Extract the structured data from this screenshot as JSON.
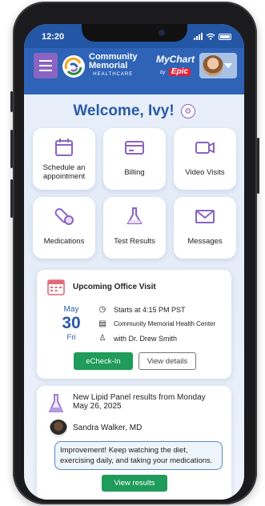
{
  "status_bar": {
    "time": "12:20"
  },
  "header": {
    "brand_line1": "Community",
    "brand_line2": "Memorial",
    "brand_line3": "HEALTHCARE",
    "mychart": "MyChart",
    "by": "by",
    "epic": "Epic",
    "brand_color": "#2f63b7",
    "menu_color": "#8a64c2"
  },
  "welcome": {
    "text": "Welcome, Ivy!"
  },
  "tiles": [
    {
      "label": "Schedule an appointment",
      "icon": "calendar-icon"
    },
    {
      "label": "Billing",
      "icon": "credit-card-icon"
    },
    {
      "label": "Video Visits",
      "icon": "video-camera-icon"
    },
    {
      "label": "Medications",
      "icon": "pill-icon"
    },
    {
      "label": "Test Results",
      "icon": "flask-icon"
    },
    {
      "label": "Messages",
      "icon": "envelope-icon"
    }
  ],
  "visit": {
    "title": "Upcoming Office Visit",
    "month": "May",
    "day": "30",
    "weekday": "Fri",
    "time": "Starts at 4:15 PM PST",
    "location": "Community Memorial Health Center",
    "provider": "with Dr. Drew Smith",
    "echeckin_label": "eCheck-In",
    "details_label": "View details"
  },
  "lipid": {
    "headline_1": "New Lipid Panel results from Monday",
    "headline_2": "May 26, 2025",
    "doctor": "Sandra Walker, MD",
    "message_1": "Improvement! Keep watching the diet,",
    "message_2": "exercising daily, and taking your medications.",
    "view_label": "View results"
  },
  "colors": {
    "accent_green": "#1f9b5a",
    "title_blue": "#2a5aa8",
    "icon_purple": "#8a64c2"
  }
}
